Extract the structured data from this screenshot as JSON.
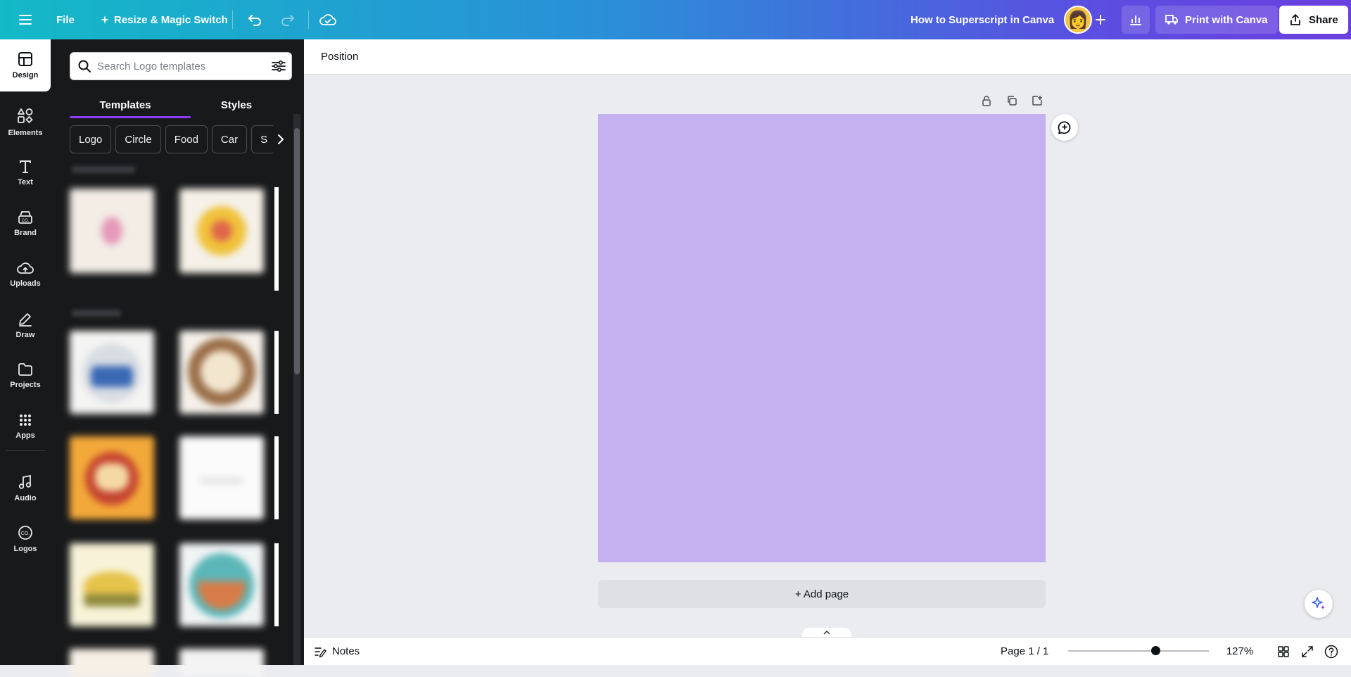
{
  "topbar": {
    "file_label": "File",
    "resize_label": "Resize & Magic Switch",
    "doc_title": "How to Superscript in Canva",
    "print_label": "Print with Canva",
    "share_label": "Share",
    "avatar_emoji": "👩"
  },
  "rail": {
    "items": [
      {
        "label": "Design",
        "icon": "design-icon"
      },
      {
        "label": "Elements",
        "icon": "elements-icon"
      },
      {
        "label": "Text",
        "icon": "text-icon"
      },
      {
        "label": "Brand",
        "icon": "brand-icon"
      },
      {
        "label": "Uploads",
        "icon": "uploads-icon"
      },
      {
        "label": "Draw",
        "icon": "draw-icon"
      },
      {
        "label": "Projects",
        "icon": "projects-icon"
      },
      {
        "label": "Apps",
        "icon": "apps-icon"
      },
      {
        "label": "Audio",
        "icon": "audio-icon"
      },
      {
        "label": "Logos",
        "icon": "logos-icon"
      }
    ]
  },
  "panel": {
    "search_placeholder": "Search Logo templates",
    "tabs": {
      "templates": "Templates",
      "styles": "Styles"
    },
    "chips": [
      "Logo",
      "Circle",
      "Food",
      "Car",
      "S"
    ]
  },
  "subbar": {
    "position_label": "Position"
  },
  "canvas": {
    "page_color": "#c5b0f0",
    "add_page_label": "+ Add page"
  },
  "footer": {
    "notes_label": "Notes",
    "page_indicator": "Page 1 / 1",
    "zoom": "127%",
    "zoom_fraction": 0.62
  },
  "colors": {
    "accent": "#8b3dff",
    "rail_bg": "#18191b"
  }
}
